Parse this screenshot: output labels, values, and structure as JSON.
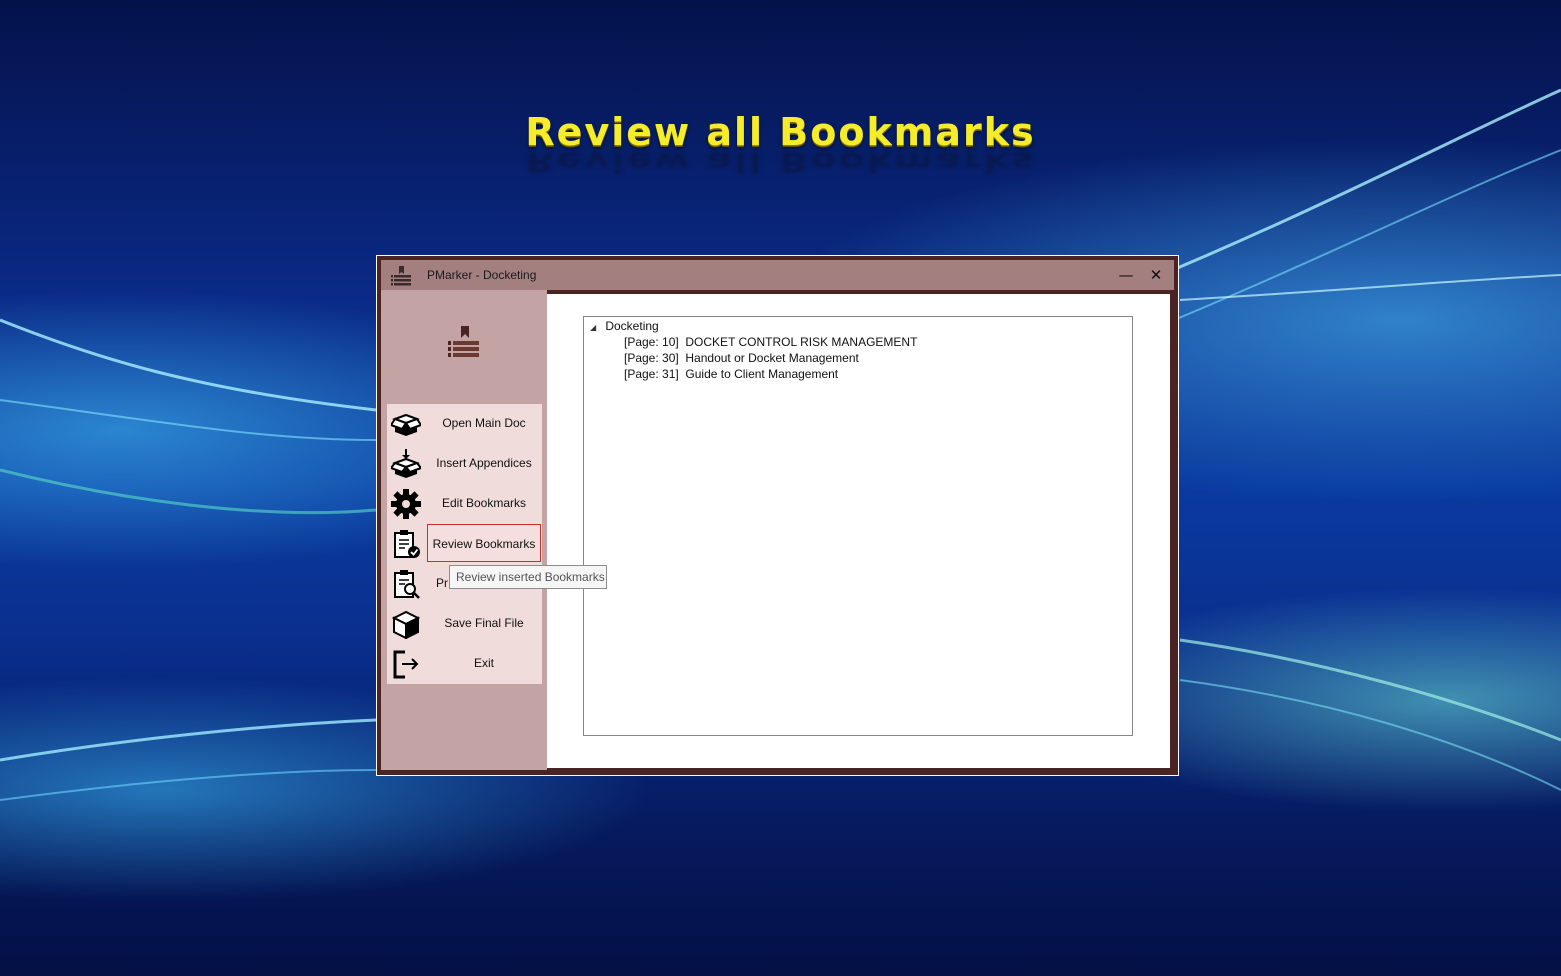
{
  "banner": {
    "title": "Review all Bookmarks"
  },
  "window": {
    "title": "PMarker - Docketing",
    "minimize_label": "—",
    "close_label": "✕"
  },
  "sidebar": {
    "items": [
      {
        "label": "Open Main Doc",
        "icon": "open-box-icon"
      },
      {
        "label": "Insert Appendices",
        "icon": "insert-box-icon"
      },
      {
        "label": "Edit Bookmarks",
        "icon": "gear-icon"
      },
      {
        "label": "Review Bookmarks",
        "icon": "clipboard-check-icon",
        "active": true
      },
      {
        "label": "Pr",
        "icon": "clipboard-search-icon"
      },
      {
        "label": "Save Final File",
        "icon": "cube-icon"
      },
      {
        "label": "Exit",
        "icon": "exit-icon"
      }
    ]
  },
  "tooltip": {
    "text": "Review inserted Bookmarks"
  },
  "tree": {
    "root": "Docketing",
    "children": [
      {
        "page": "[Page: 10]",
        "title": "DOCKET CONTROL RISK MANAGEMENT"
      },
      {
        "page": "[Page: 30]",
        "title": "Handout or Docket Management"
      },
      {
        "page": "[Page: 31]",
        "title": "Guide to Client Management"
      }
    ]
  },
  "colors": {
    "window_frame": "#4a2323",
    "titlebar": "#a37f80",
    "sidebar": "#c3a3a3",
    "menu": "#f1dcdc",
    "active_border": "#c0332f",
    "banner_text": "#f5ec2c"
  }
}
